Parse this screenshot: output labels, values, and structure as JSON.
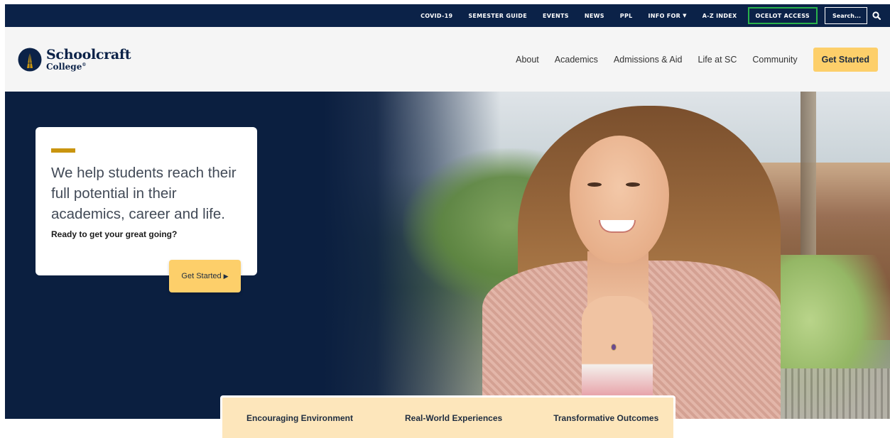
{
  "utility_nav": {
    "links": [
      "COVID-19",
      "SEMESTER GUIDE",
      "EVENTS",
      "NEWS",
      "PPL"
    ],
    "info_for": "INFO FOR",
    "az_index": "A-Z INDEX",
    "ocelot_access": "OCELOT ACCESS",
    "search_placeholder": "Search...",
    "search_icon": "magnifier-icon"
  },
  "header": {
    "logo_line1": "Schoolcraft",
    "logo_line2": "College",
    "logo_mark": "®",
    "nav": [
      "About",
      "Academics",
      "Admissions & Aid",
      "Life at SC",
      "Community"
    ],
    "cta": "Get Started"
  },
  "hero": {
    "heading": "We help students reach their full potential in their academics, career and life.",
    "subheading": "Ready to get your great going?",
    "cta": "Get Started",
    "cta_icon": "triangle-right-icon"
  },
  "features": [
    "Encouraging Environment",
    "Real-World Experiences",
    "Transformative Outcomes"
  ],
  "colors": {
    "navy": "#0b2248",
    "gold": "#fdcf6a",
    "accent": "#c9950f",
    "band": "#fde6bb",
    "highlight": "#2ab24b"
  }
}
